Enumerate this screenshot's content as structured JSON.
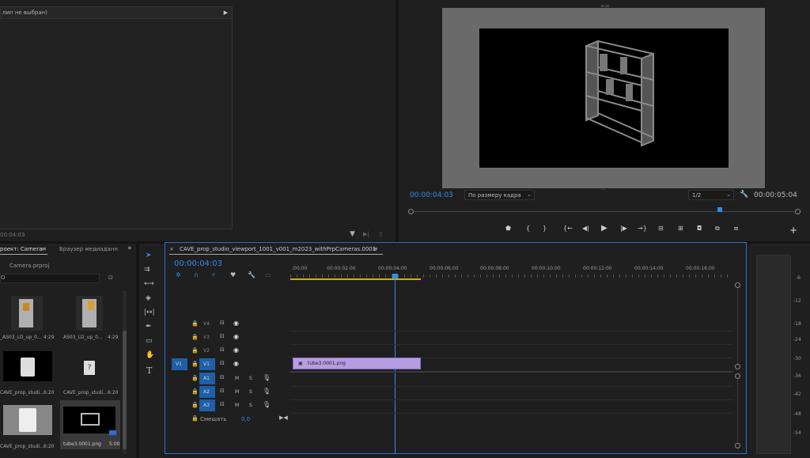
{
  "source_panel": {
    "clip_label": "лип не выбран)",
    "timecode": "00:04:03"
  },
  "program": {
    "timecode": "00:00:04:03",
    "fit_select": "По размеру кадра",
    "resolution_select": "1/2",
    "duration": "00:00:05:04"
  },
  "project": {
    "tab_project": "роект: Camera",
    "tab_media": "Браузер медиаданн",
    "file": "Camera.prproj",
    "items": [
      {
        "name": "_AS03_LD_up_0...",
        "dur": "4:29",
        "thumb": "can"
      },
      {
        "name": "AS03_LD_up_0...",
        "dur": "4:29",
        "thumb": "can2"
      },
      {
        "name": "CAVE_prop_studi...",
        "dur": "6:20",
        "thumb": "camera-dark"
      },
      {
        "name": "CAVE_prop_studi...",
        "dur": "6:20",
        "thumb": "missing"
      },
      {
        "name": "CAVE_prop_studi...",
        "dur": "6:20",
        "thumb": "camera-light"
      },
      {
        "name": "tube3.0001.png",
        "dur": "5:00",
        "thumb": "shelf"
      }
    ]
  },
  "timeline": {
    "sequence_title": "CAVE_prop_studio_viewport_1001_v001_m2023_withPrpCameras.0001",
    "timecode": "00:00:04:03",
    "ruler": [
      ":00:00",
      "00:00:02:00",
      "00:00:04:00",
      "00:00:06:00",
      "00:00:08:00",
      "00:00:10:00",
      "00:00:12:00",
      "00:00:14:00",
      "00:00:16:00"
    ],
    "video_tracks": [
      "V4",
      "V3",
      "V2",
      "V1"
    ],
    "audio_tracks": [
      "A1",
      "A2",
      "A3"
    ],
    "source_v": "V1",
    "mute": "M",
    "solo": "S",
    "mix_label": "Смешать",
    "mix_value": "0,0",
    "clip_name": "tube3.0001.png"
  },
  "meter": {
    "labels": [
      "-6",
      "-12",
      "-18",
      "-24",
      "-30",
      "-36",
      "-42",
      "-48",
      "-54"
    ]
  }
}
